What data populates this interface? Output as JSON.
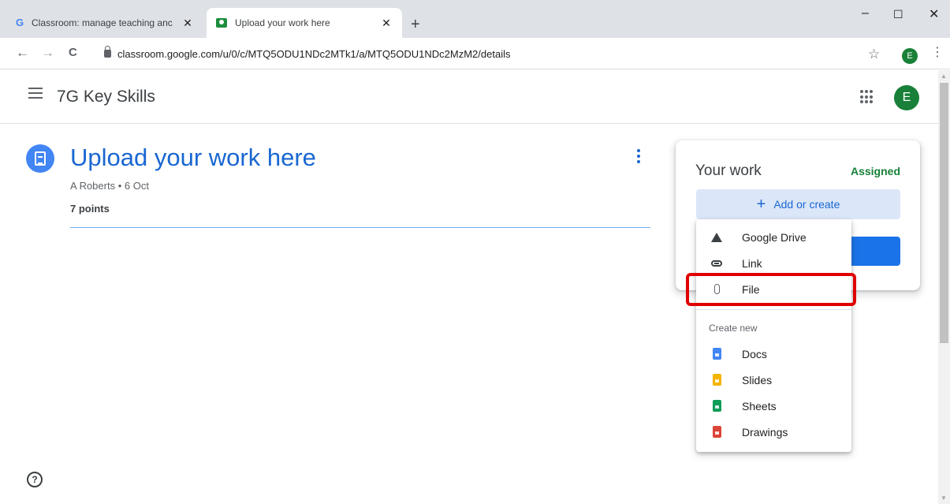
{
  "browser": {
    "tabs": [
      {
        "title": "Classroom: manage teaching anc",
        "close": "✕",
        "favicon": "G"
      },
      {
        "title": "Upload your work here",
        "close": "✕"
      }
    ],
    "new_tab": "+",
    "window": {
      "minimize": "–",
      "maximize": "☐",
      "close": "✕"
    },
    "nav": {
      "back": "←",
      "forward": "→",
      "reload": "C"
    },
    "url": "classroom.google.com/u/0/c/MTQ5ODU1NDc2MTk1/a/MTQ5ODU1NDc2MzM2/details",
    "bookmark_star": "☆",
    "profile_initial": "E",
    "menu_glyph": "⋮"
  },
  "header": {
    "class_name": "7G Key Skills",
    "avatar_initial": "E"
  },
  "assignment": {
    "title": "Upload your work here",
    "meta": "A Roberts • 6 Oct",
    "points": "7 points"
  },
  "work_card": {
    "title": "Your work",
    "status": "Assigned",
    "add_plus": "+",
    "add_label": "Add or create"
  },
  "add_menu": {
    "items": [
      {
        "label": "Google Drive",
        "icon": "drive-icon"
      },
      {
        "label": "Link",
        "icon": "link-icon"
      },
      {
        "label": "File",
        "icon": "paperclip-icon"
      }
    ],
    "create_section": "Create new",
    "create_items": [
      {
        "label": "Docs",
        "icon": "docs-icon",
        "color": "#4285f4"
      },
      {
        "label": "Slides",
        "icon": "slides-icon",
        "color": "#f4b400"
      },
      {
        "label": "Sheets",
        "icon": "sheets-icon",
        "color": "#0f9d58"
      },
      {
        "label": "Drawings",
        "icon": "drawings-icon",
        "color": "#db4437"
      }
    ]
  },
  "colors": {
    "accent": "#1967d2",
    "assigned": "#188038",
    "highlight": "#e00000"
  },
  "help": "?"
}
